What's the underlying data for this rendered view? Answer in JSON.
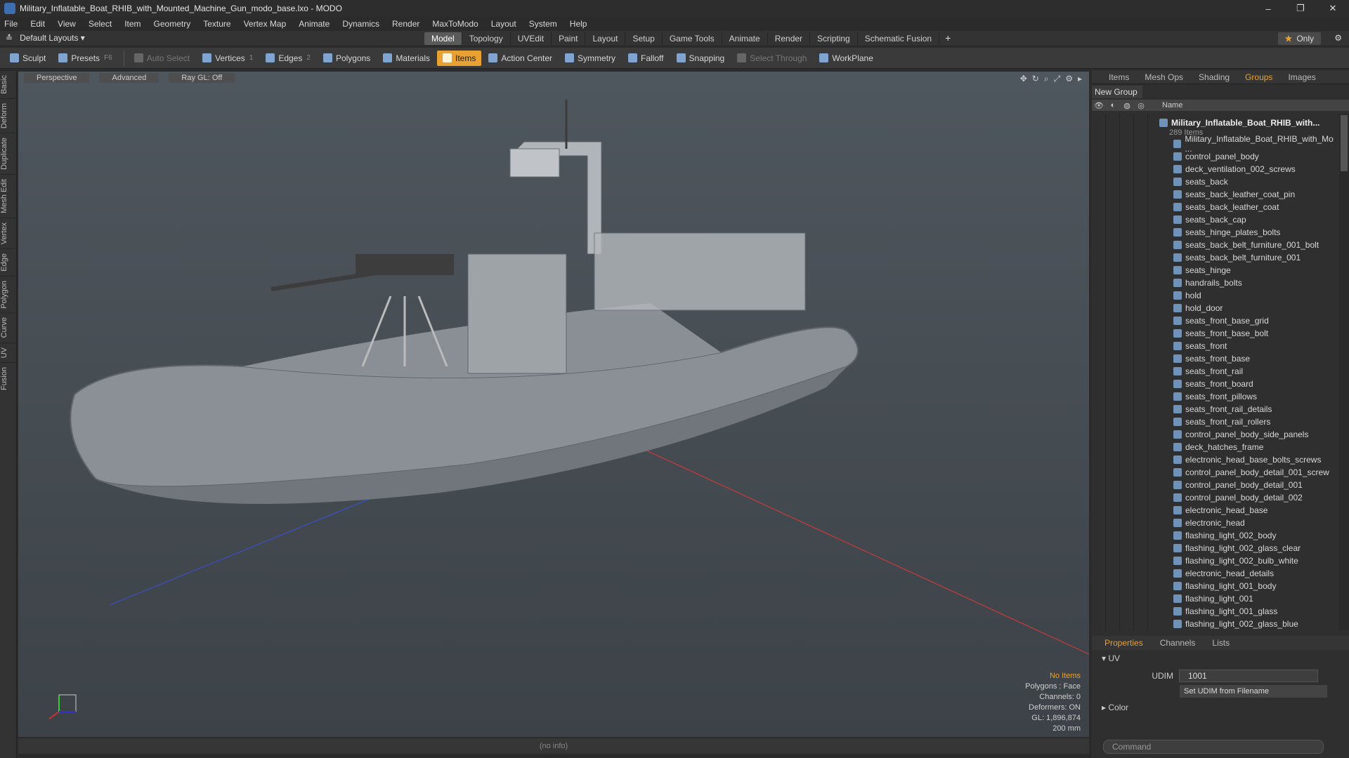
{
  "window": {
    "title": "Military_Inflatable_Boat_RHIB_with_Mounted_Machine_Gun_modo_base.lxo - MODO",
    "controls": [
      "–",
      "❐",
      "✕"
    ]
  },
  "menu": [
    "File",
    "Edit",
    "View",
    "Select",
    "Item",
    "Geometry",
    "Texture",
    "Vertex Map",
    "Animate",
    "Dynamics",
    "Render",
    "MaxToModo",
    "Layout",
    "System",
    "Help"
  ],
  "layouts": {
    "label": "Default Layouts ▾"
  },
  "tabs": [
    "Model",
    "Topology",
    "UVEdit",
    "Paint",
    "Layout",
    "Setup",
    "Game Tools",
    "Animate",
    "Render",
    "Scripting",
    "Schematic Fusion"
  ],
  "tabs_active": "Model",
  "only_label": "Only",
  "toolbar": {
    "sculpt": "Sculpt",
    "presets": "Presets",
    "presets_key": "F6",
    "auto_select": "Auto Select",
    "vertices": "Vertices",
    "vertices_key": "1",
    "edges": "Edges",
    "edges_key": "2",
    "polygons": "Polygons",
    "materials": "Materials",
    "items": "Items",
    "action_center": "Action Center",
    "symmetry": "Symmetry",
    "falloff": "Falloff",
    "snapping": "Snapping",
    "select_through": "Select Through",
    "workplane": "WorkPlane"
  },
  "left_tabs": [
    "Basic",
    "Deform",
    "Duplicate",
    "Mesh Edit",
    "Vertex",
    "Edge",
    "Polygon",
    "Curve",
    "UV",
    "Fusion"
  ],
  "viewport": {
    "mode": "Perspective",
    "shading": "Advanced",
    "raygl": "Ray GL: Off",
    "info": {
      "selection": "No Items",
      "polygons": "Polygons : Face",
      "channels": "Channels: 0",
      "deformers": "Deformers: ON",
      "gl": "GL: 1,896,874",
      "scale": "200 mm"
    },
    "status": "(no info)"
  },
  "right_tabs": [
    "Items",
    "Mesh Ops",
    "Shading",
    "Groups",
    "Images"
  ],
  "right_tab_active": "Groups",
  "new_group": "New Group",
  "tree_header": "Name",
  "tree": {
    "root": "Military_Inflatable_Boat_RHIB_with...",
    "count": "289 Items",
    "items": [
      "Military_Inflatable_Boat_RHIB_with_Mo ...",
      "control_panel_body",
      "deck_ventilation_002_screws",
      "seats_back",
      "seats_back_leather_coat_pin",
      "seats_back_leather_coat",
      "seats_back_cap",
      "seats_hinge_plates_bolts",
      "seats_back_belt_furniture_001_bolt",
      "seats_back_belt_furniture_001",
      "seats_hinge",
      "handrails_bolts",
      "hold",
      "hold_door",
      "seats_front_base_grid",
      "seats_front_base_bolt",
      "seats_front",
      "seats_front_base",
      "seats_front_rail",
      "seats_front_board",
      "seats_front_pillows",
      "seats_front_rail_details",
      "seats_front_rail_rollers",
      "control_panel_body_side_panels",
      "deck_hatches_frame",
      "electronic_head_base_bolts_screws",
      "control_panel_body_detail_001_screw",
      "control_panel_body_detail_001",
      "control_panel_body_detail_002",
      "electronic_head_base",
      "electronic_head",
      "flashing_light_002_body",
      "flashing_light_002_glass_clear",
      "flashing_light_002_bulb_white",
      "electronic_head_details",
      "flashing_light_001_body",
      "flashing_light_001",
      "flashing_light_001_glass",
      "flashing_light_002_glass_blue"
    ]
  },
  "prop_tabs": [
    "Properties",
    "Channels",
    "Lists"
  ],
  "prop_tab_active": "Properties",
  "props": {
    "uv_section": "UV",
    "udim_label": "UDIM",
    "udim_value": "1001",
    "set_udim": "Set UDIM from Filename",
    "color_section": "Color"
  },
  "command_placeholder": "Command",
  "colors": {
    "accent": "#e9a232",
    "panel": "#2f2f2f",
    "viewport_top": "#4f575e",
    "viewport_bottom": "#3c4247"
  }
}
